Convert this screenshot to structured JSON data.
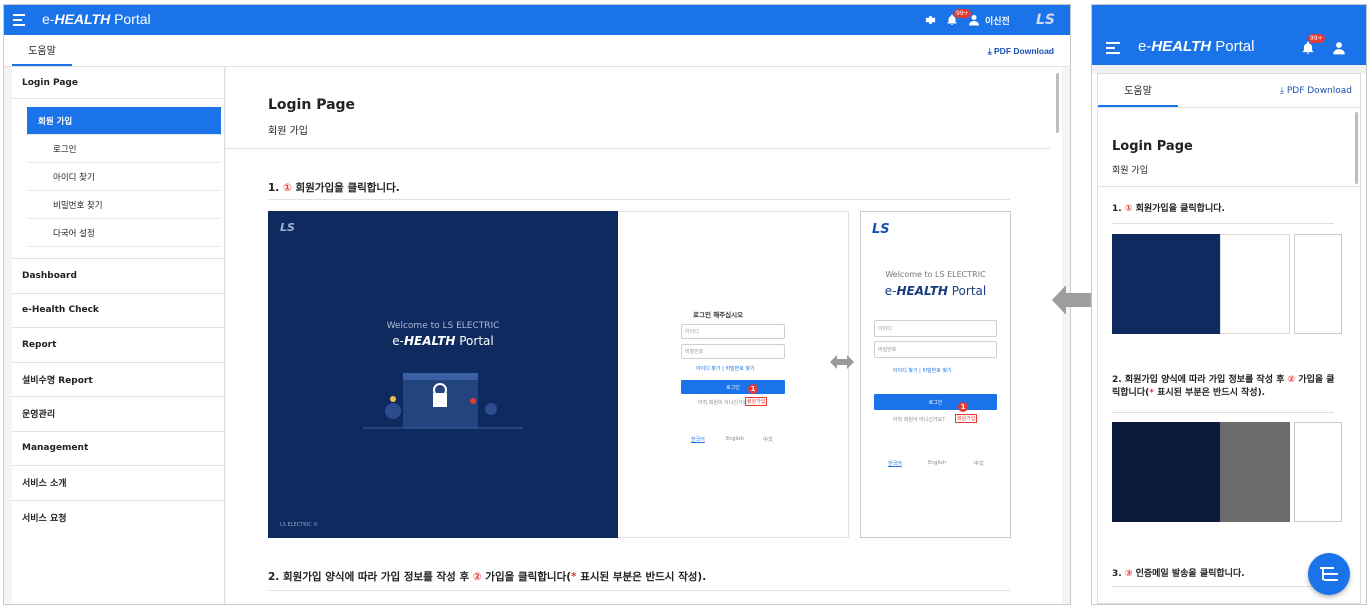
{
  "app": {
    "brand_prefix": "e-",
    "brand_bold": "HEALTH",
    "brand_rest": " Portal",
    "user": "이신전",
    "notification_badge": "99+",
    "accent": "#1a73e8"
  },
  "tabs": {
    "help": "도움말",
    "pdf_download": "PDF Download"
  },
  "sidebar": {
    "section_login": "Login Page",
    "sub": [
      "회원 가입",
      "로그인",
      "아이디 찾기",
      "비밀번호 찾기",
      "다국어 설정"
    ],
    "items": [
      "Dashboard",
      "e-Health Check",
      "Report",
      "설비수명 Report",
      "운영관리",
      "Management",
      "서비스 소개",
      "서비스 요청"
    ]
  },
  "content": {
    "title": "Login Page",
    "subtitle": "회원 가입",
    "step1_num": "①",
    "step1_text": "회원가입을 클릭합니다.",
    "step2_num": "②",
    "step2_pre": "회원가입 양식에 따라 가입 정보를 작성 후 ",
    "step2_post": " 가입을 클릭합니다(",
    "step2_star": "*",
    "step2_end": " 표시된 부분은 반드시 작성).",
    "step3_num": "③",
    "step3_text": "인증메일 발송을 클릭합니다."
  },
  "mockup": {
    "logo": "LS",
    "welcome": "Welcome to LS ELECTRIC",
    "portal_bold": "HEALTH",
    "portal_rest": " Portal",
    "login_prompt": "로그인 해주십시오",
    "id_placeholder": "아이디",
    "pw_placeholder": "비밀번호",
    "links": "아이디 찾기  |  비밀번호 찾기",
    "login_btn": "로그인",
    "not_member": "아직 회원이 아니신가요?",
    "signup": "회원가입",
    "lang_ko": "한국어",
    "lang_en": "English",
    "lang_other": "中文",
    "footer": "LS ELECTRIC ©",
    "marker1": "1"
  }
}
